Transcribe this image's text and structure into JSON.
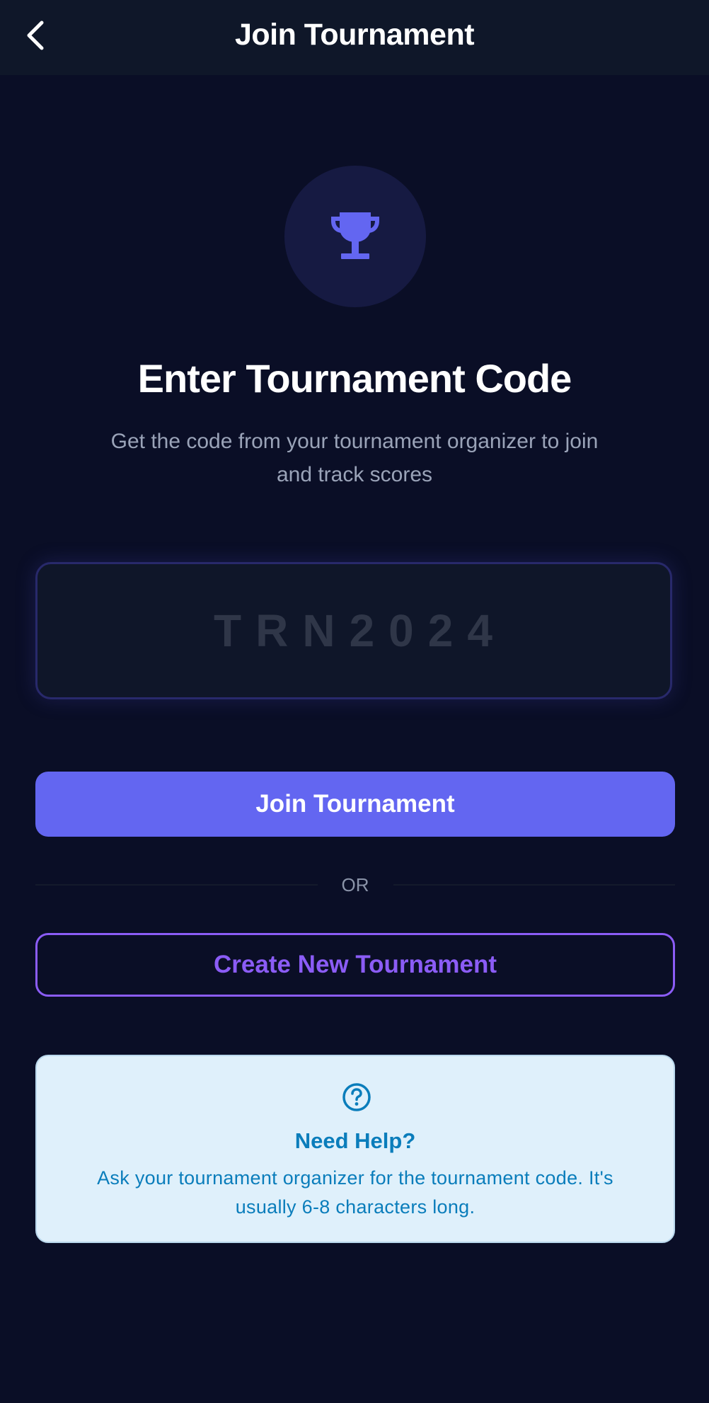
{
  "header": {
    "title": "Join Tournament",
    "back_icon": "chevron-left-icon"
  },
  "hero": {
    "icon": "trophy-icon",
    "icon_color": "#6366f1",
    "title": "Enter Tournament Code",
    "subtitle": "Get the code from your tournament organizer to join and track scores"
  },
  "code_input": {
    "value": "",
    "placeholder": "TRN2024"
  },
  "actions": {
    "join_label": "Join Tournament",
    "divider_label": "OR",
    "create_label": "Create New Tournament"
  },
  "help": {
    "icon": "question-circle-icon",
    "title": "Need Help?",
    "text": "Ask your tournament organizer for the tournament code. It's usually 6-8 characters long."
  },
  "colors": {
    "background": "#0a0e26",
    "header_background": "#0f1729",
    "primary": "#6366f1",
    "secondary": "#8b5cf6",
    "help_background": "#dff0fb",
    "help_text": "#0a7dbb"
  }
}
